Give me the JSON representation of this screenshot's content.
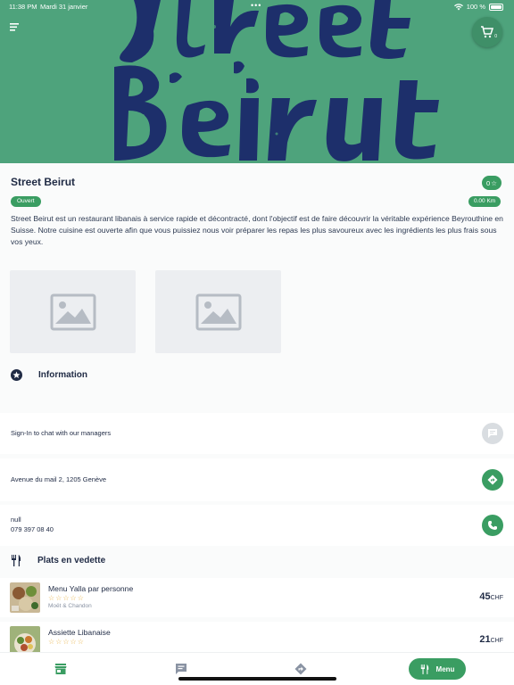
{
  "status_bar": {
    "time": "11:38 PM",
    "date": "Mardi 31 janvier",
    "battery": "100 %"
  },
  "restaurant": {
    "name": "Street Beirut",
    "rating": "0",
    "status": "Ouvert",
    "distance": "0.00 Km",
    "description": "Street Beirut est un restaurant libanais à service rapide et décontracté, dont l'objectif est de faire découvrir la véritable expérience Beyrouthine en Suisse. Notre cuisine est ouverte afin que vous puissiez nous voir préparer les repas les plus savoureux avec les ingrédients les plus frais sous vos yeux."
  },
  "cart": {
    "count": "0"
  },
  "information": {
    "title": "Information",
    "chat_text": "Sign-In to chat with our managers",
    "address": "Avenue du mail 2, 1205 Genève",
    "contact_name": "null",
    "phone": "079 397 08 40"
  },
  "featured": {
    "title": "Plats en vedette",
    "dishes": [
      {
        "name": "Menu Yalla par personne",
        "stars": "☆☆☆☆☆",
        "subtitle": "Moët & Chandon",
        "price": "45",
        "currency": "CHF"
      },
      {
        "name": "Assiette Libanaise",
        "stars": "☆☆☆☆☆",
        "subtitle": "",
        "price": "21",
        "currency": "CHF"
      }
    ]
  },
  "bottom_nav": {
    "menu_label": "Menu"
  },
  "colors": {
    "brand_green": "#3a9d62",
    "hero_green": "#4ea37c",
    "navy": "#1f2a44"
  },
  "icons": [
    "hamburger-icon",
    "cart-icon",
    "star-icon",
    "image-placeholder-icon",
    "chat-icon",
    "directions-icon",
    "phone-icon",
    "cutlery-icon",
    "store-icon"
  ]
}
